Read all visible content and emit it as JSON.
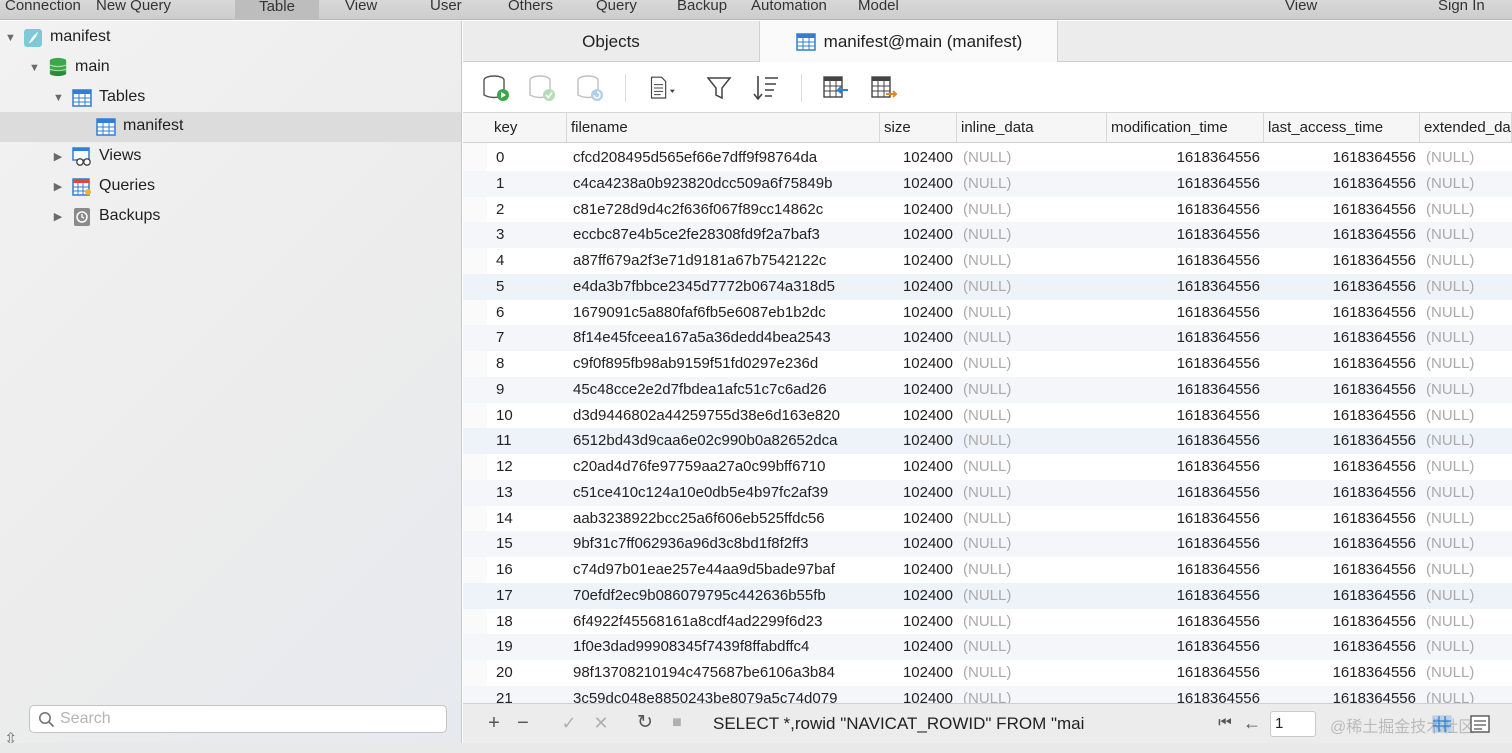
{
  "toolbar": {
    "items": [
      "Connection",
      "New Query",
      "Table",
      "View",
      "User",
      "Others",
      "Query",
      "Backup",
      "Automation",
      "Model"
    ],
    "active": "Table",
    "right_items": [
      "View",
      "Sign In"
    ]
  },
  "sidebar": {
    "connection": "manifest",
    "database": "main",
    "tables_label": "Tables",
    "table_item": "manifest",
    "views_label": "Views",
    "queries_label": "Queries",
    "backups_label": "Backups",
    "search_placeholder": "Search"
  },
  "tabs": {
    "objects": "Objects",
    "active": "manifest@main (manifest)"
  },
  "grid": {
    "columns": [
      "key",
      "filename",
      "size",
      "inline_data",
      "modification_time",
      "last_access_time",
      "extended_da"
    ],
    "rows": [
      [
        "0",
        "cfcd208495d565ef66e7dff9f98764da",
        "102400",
        "(NULL)",
        "1618364556",
        "1618364556",
        "(NULL)"
      ],
      [
        "1",
        "c4ca4238a0b923820dcc509a6f75849b",
        "102400",
        "(NULL)",
        "1618364556",
        "1618364556",
        "(NULL)"
      ],
      [
        "2",
        "c81e728d9d4c2f636f067f89cc14862c",
        "102400",
        "(NULL)",
        "1618364556",
        "1618364556",
        "(NULL)"
      ],
      [
        "3",
        "eccbc87e4b5ce2fe28308fd9f2a7baf3",
        "102400",
        "(NULL)",
        "1618364556",
        "1618364556",
        "(NULL)"
      ],
      [
        "4",
        "a87ff679a2f3e71d9181a67b7542122c",
        "102400",
        "(NULL)",
        "1618364556",
        "1618364556",
        "(NULL)"
      ],
      [
        "5",
        "e4da3b7fbbce2345d7772b0674a318d5",
        "102400",
        "(NULL)",
        "1618364556",
        "1618364556",
        "(NULL)"
      ],
      [
        "6",
        "1679091c5a880faf6fb5e6087eb1b2dc",
        "102400",
        "(NULL)",
        "1618364556",
        "1618364556",
        "(NULL)"
      ],
      [
        "7",
        "8f14e45fceea167a5a36dedd4bea2543",
        "102400",
        "(NULL)",
        "1618364556",
        "1618364556",
        "(NULL)"
      ],
      [
        "8",
        "c9f0f895fb98ab9159f51fd0297e236d",
        "102400",
        "(NULL)",
        "1618364556",
        "1618364556",
        "(NULL)"
      ],
      [
        "9",
        "45c48cce2e2d7fbdea1afc51c7c6ad26",
        "102400",
        "(NULL)",
        "1618364556",
        "1618364556",
        "(NULL)"
      ],
      [
        "10",
        "d3d9446802a44259755d38e6d163e820",
        "102400",
        "(NULL)",
        "1618364556",
        "1618364556",
        "(NULL)"
      ],
      [
        "11",
        "6512bd43d9caa6e02c990b0a82652dca",
        "102400",
        "(NULL)",
        "1618364556",
        "1618364556",
        "(NULL)"
      ],
      [
        "12",
        "c20ad4d76fe97759aa27a0c99bff6710",
        "102400",
        "(NULL)",
        "1618364556",
        "1618364556",
        "(NULL)"
      ],
      [
        "13",
        "c51ce410c124a10e0db5e4b97fc2af39",
        "102400",
        "(NULL)",
        "1618364556",
        "1618364556",
        "(NULL)"
      ],
      [
        "14",
        "aab3238922bcc25a6f606eb525ffdc56",
        "102400",
        "(NULL)",
        "1618364556",
        "1618364556",
        "(NULL)"
      ],
      [
        "15",
        "9bf31c7ff062936a96d3c8bd1f8f2ff3",
        "102400",
        "(NULL)",
        "1618364556",
        "1618364556",
        "(NULL)"
      ],
      [
        "16",
        "c74d97b01eae257e44aa9d5bade97baf",
        "102400",
        "(NULL)",
        "1618364556",
        "1618364556",
        "(NULL)"
      ],
      [
        "17",
        "70efdf2ec9b086079795c442636b55fb",
        "102400",
        "(NULL)",
        "1618364556",
        "1618364556",
        "(NULL)"
      ],
      [
        "18",
        "6f4922f45568161a8cdf4ad2299f6d23",
        "102400",
        "(NULL)",
        "1618364556",
        "1618364556",
        "(NULL)"
      ],
      [
        "19",
        "1f0e3dad99908345f7439f8ffabdffc4",
        "102400",
        "(NULL)",
        "1618364556",
        "1618364556",
        "(NULL)"
      ],
      [
        "20",
        "98f13708210194c475687be6106a3b84",
        "102400",
        "(NULL)",
        "1618364556",
        "1618364556",
        "(NULL)"
      ],
      [
        "21",
        "3c59dc048e8850243be8079a5c74d079",
        "102400",
        "(NULL)",
        "1618364556",
        "1618364556",
        "(NULL)"
      ]
    ]
  },
  "bottom": {
    "sql": "SELECT *,rowid \"NAVICAT_ROWID\" FROM \"mai",
    "page": "1",
    "watermark": "@稀土掘金技术社区"
  },
  "colors": {
    "accent_blue": "#2f7fd6",
    "green_db": "#3aa84a",
    "null_text": "#aaaaaa"
  }
}
